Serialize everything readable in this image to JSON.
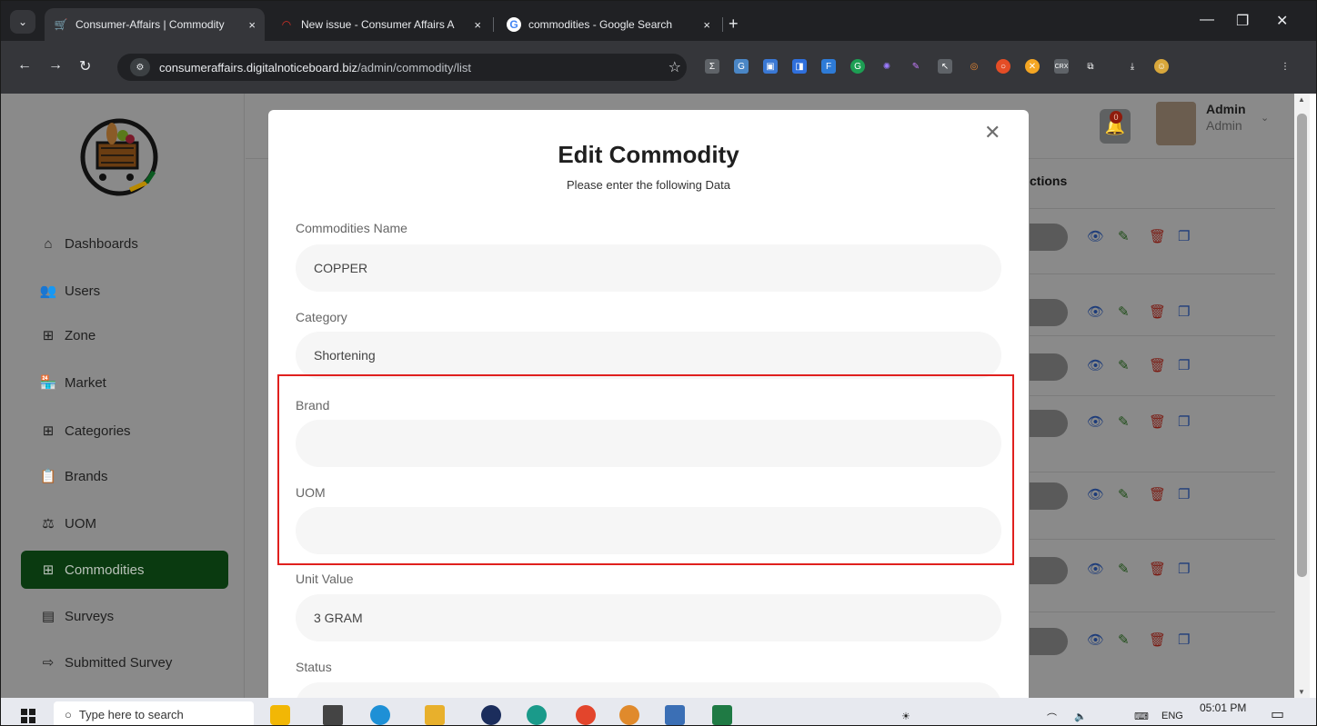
{
  "browser": {
    "tabs": [
      {
        "title": "Consumer-Affairs | Commodity",
        "active": true
      },
      {
        "title": "New issue - Consumer Affairs A",
        "active": false
      },
      {
        "title": "commodities - Google Search",
        "active": false
      }
    ],
    "tab_close_glyph": "×",
    "new_tab_glyph": "+",
    "url_host": "consumeraffairs.digitalnoticeboard.biz",
    "url_path": "/admin/commodity/list"
  },
  "sidebar": {
    "items": [
      {
        "label": "Dashboards",
        "icon": "home-icon"
      },
      {
        "label": "Users",
        "icon": "users-icon"
      },
      {
        "label": "Zone",
        "icon": "grid-icon"
      },
      {
        "label": "Market",
        "icon": "store-icon"
      },
      {
        "label": "Categories",
        "icon": "grid-icon"
      },
      {
        "label": "Brands",
        "icon": "clipboard-icon"
      },
      {
        "label": "UOM",
        "icon": "scale-icon"
      },
      {
        "label": "Commodities",
        "icon": "grid-icon",
        "active": true
      },
      {
        "label": "Surveys",
        "icon": "form-icon"
      },
      {
        "label": "Submitted Survey",
        "icon": "file-export-icon"
      }
    ]
  },
  "header": {
    "notification_count": "0",
    "admin_name": "Admin",
    "admin_role": "Admin"
  },
  "table": {
    "actions_header": "ctions"
  },
  "modal": {
    "title": "Edit Commodity",
    "subtitle": "Please enter the following Data",
    "fields": [
      {
        "label": "Commodities Name",
        "value": "COPPER"
      },
      {
        "label": "Category",
        "value": "Shortening"
      },
      {
        "label": "Brand",
        "value": ""
      },
      {
        "label": "UOM",
        "value": ""
      },
      {
        "label": "Unit Value",
        "value": "3 GRAM"
      },
      {
        "label": "Status",
        "value": ""
      }
    ]
  },
  "taskbar": {
    "search_placeholder": "Type here to search",
    "time": "05:01 PM",
    "language": "ENG"
  },
  "colors": {
    "active_nav_bg": "#0a3a10",
    "highlight_border": "#e0201e",
    "overlay": "#8a8a8a"
  }
}
